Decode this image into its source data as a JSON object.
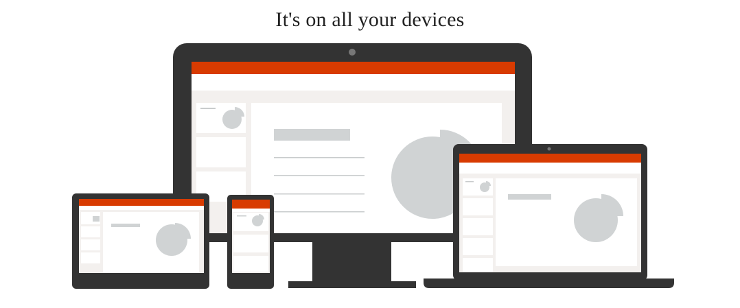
{
  "headline": "It's on all your devices",
  "illustration": {
    "devices": [
      "desktop-monitor",
      "tablet",
      "phone",
      "laptop"
    ],
    "icons": [
      "pie-chart-icon",
      "camera-dot-icon"
    ],
    "colors": {
      "device_body": "#333333",
      "ribbon": "#D83B01",
      "canvas_bg": "#F3F0EE",
      "slide_bg": "#FFFFFF",
      "chart_gray": "#D0D3D4",
      "line_gray": "#C9CCCD",
      "camera": "#777777"
    }
  }
}
